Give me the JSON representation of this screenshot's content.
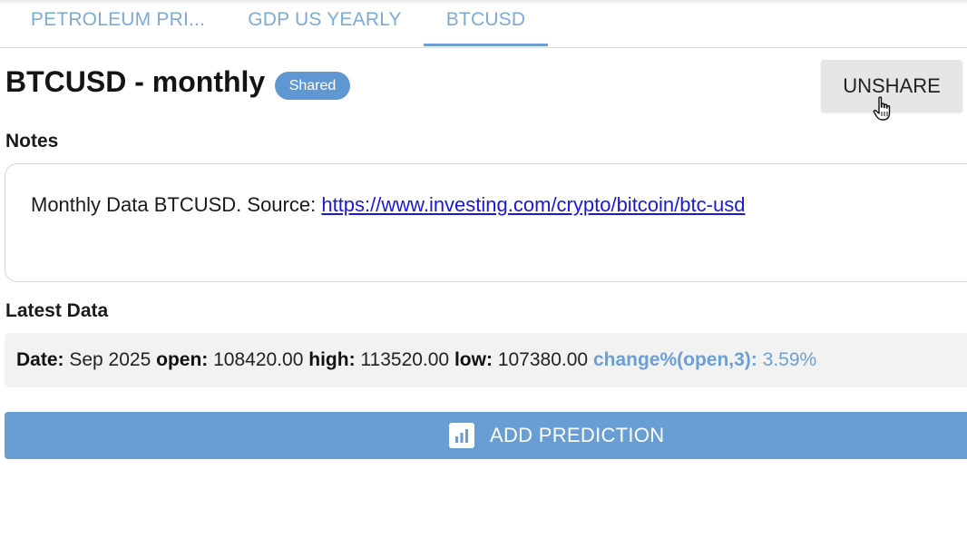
{
  "tabs": [
    {
      "label": "PETROLEUM PRI..."
    },
    {
      "label": "GDP US YEARLY"
    },
    {
      "label": "BTCUSD"
    }
  ],
  "header": {
    "title": "BTCUSD - monthly",
    "badge": "Shared",
    "unshare_label": "UNSHARE"
  },
  "notes": {
    "label": "Notes",
    "text": "Monthly Data BTCUSD. Source: ",
    "link": "https://www.investing.com/crypto/bitcoin/btc-usd"
  },
  "latest": {
    "label": "Latest Data",
    "date_label": "Date:",
    "date_value": "Sep 2025",
    "open_label": "open:",
    "open_value": "108420.00",
    "high_label": "high:",
    "high_value": "113520.00",
    "low_label": "low:",
    "low_value": "107380.00",
    "change_label": "change%(open,3):",
    "change_value": "3.59%"
  },
  "actions": {
    "add_prediction": "ADD PREDICTION"
  },
  "colors": {
    "accent": "#6c9fd3",
    "badge": "#5f97d2",
    "button": "#699ed4",
    "link": "#1a1ad6"
  },
  "icons": {
    "add_prediction": "bar-chart-icon",
    "cursor": "hand-pointer-icon"
  }
}
